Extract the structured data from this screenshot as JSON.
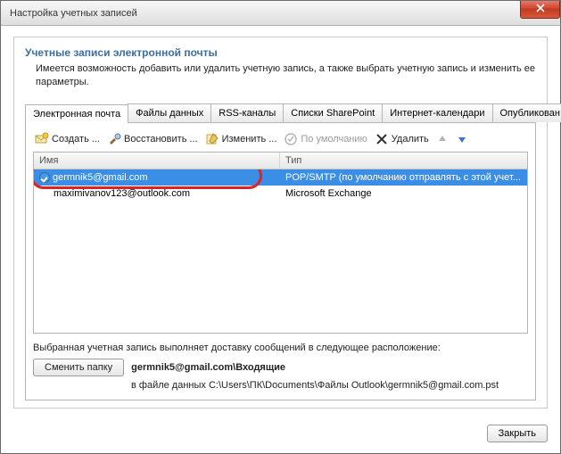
{
  "window": {
    "title": "Настройка учетных записей"
  },
  "header": {
    "title": "Учетные записи электронной почты",
    "desc": "Имеется возможность добавить или удалить учетную запись, а также выбрать учетную запись и изменить ее параметры."
  },
  "tabs": [
    {
      "label": "Электронная почта",
      "active": true
    },
    {
      "label": "Файлы данных"
    },
    {
      "label": "RSS-каналы"
    },
    {
      "label": "Списки SharePoint"
    },
    {
      "label": "Интернет-календари"
    },
    {
      "label": "Опубликован"
    }
  ],
  "toolbar": {
    "create": "Создать",
    "restore": "Восстановить",
    "edit": "Изменить",
    "default": "По умолчанию",
    "delete": "Удалить"
  },
  "grid": {
    "columns": {
      "name": "Имя",
      "type": "Тип"
    },
    "rows": [
      {
        "name": "germnik5@gmail.com",
        "type": "POP/SMTP (по умолчанию отправлять с этой учет...",
        "selected": true,
        "default": true
      },
      {
        "name": "maximivanov123@outlook.com",
        "type": "Microsoft Exchange",
        "selected": false,
        "default": false
      }
    ]
  },
  "delivery": {
    "intro": "Выбранная учетная запись выполняет доставку сообщений в следующее расположение:",
    "change_folder_btn": "Сменить папку",
    "folder_bold": "germnik5@gmail.com\\Входящие",
    "path": "в файле данных C:\\Users\\ПК\\Documents\\Файлы Outlook\\germnik5@gmail.com.pst"
  },
  "footer": {
    "close": "Закрыть"
  }
}
